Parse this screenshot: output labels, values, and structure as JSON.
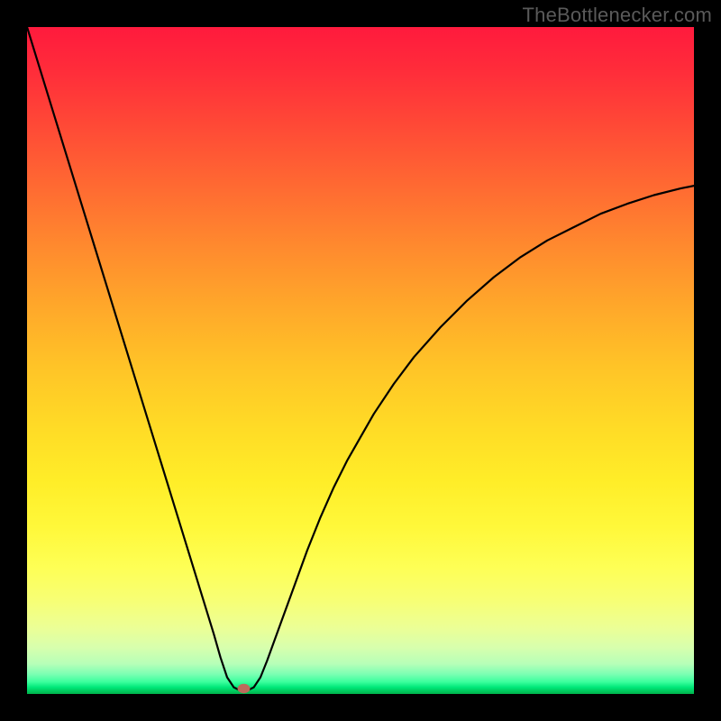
{
  "watermark": "TheBottlenecker.com",
  "chart_data": {
    "type": "line",
    "title": "",
    "xlabel": "",
    "ylabel": "",
    "xlim": [
      0,
      100
    ],
    "ylim": [
      0,
      100
    ],
    "x": [
      0,
      2,
      4,
      6,
      8,
      10,
      12,
      14,
      16,
      18,
      20,
      22,
      24,
      26,
      28,
      29,
      30,
      31,
      32,
      33,
      34,
      35,
      36,
      38,
      40,
      42,
      44,
      46,
      48,
      50,
      52,
      55,
      58,
      62,
      66,
      70,
      74,
      78,
      82,
      86,
      90,
      94,
      98,
      100
    ],
    "values": [
      100,
      93.5,
      87,
      80.5,
      74,
      67.5,
      61,
      54.5,
      48,
      41.5,
      35,
      28.5,
      22,
      15.5,
      9,
      5.5,
      2.5,
      1.0,
      0.5,
      0.5,
      1.0,
      2.5,
      5.0,
      10.5,
      16,
      21.5,
      26.5,
      31,
      35,
      38.5,
      42,
      46.5,
      50.5,
      55,
      59,
      62.5,
      65.5,
      68,
      70,
      72,
      73.5,
      74.8,
      75.8,
      76.2
    ],
    "marker": {
      "x": 32.5,
      "y": 0.8,
      "color": "#bc6a5b"
    },
    "gradient_stops": [
      {
        "pos": 0,
        "color": "#ff1a3d"
      },
      {
        "pos": 50,
        "color": "#ffd326"
      },
      {
        "pos": 85,
        "color": "#fbff6a"
      },
      {
        "pos": 100,
        "color": "#00b24c"
      }
    ]
  }
}
